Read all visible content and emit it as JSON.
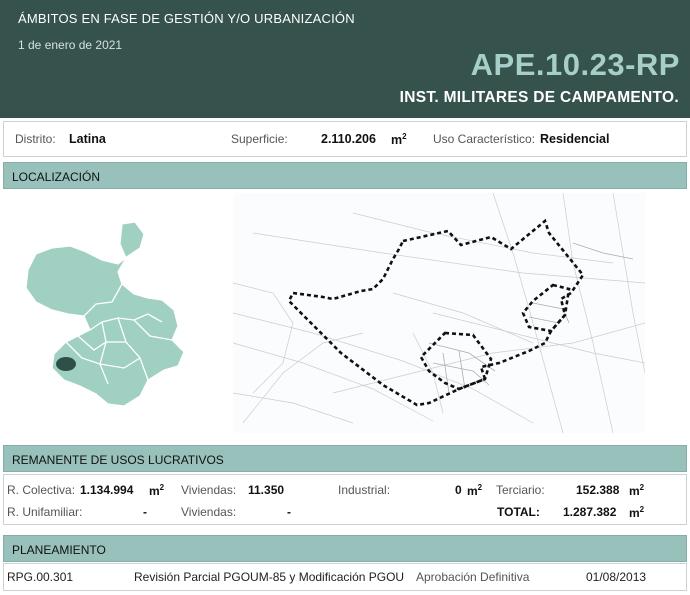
{
  "header": {
    "category": "ÁMBITOS EN FASE DE GESTIÓN Y/O URBANIZACIÓN",
    "date": "1 de enero de 2021",
    "code": "APE.10.23-RP",
    "name": "INST. MILITARES DE CAMPAMENTO."
  },
  "info": {
    "distrito_label": "Distrito:",
    "distrito_value": "Latina",
    "superficie_label": "Superficie:",
    "superficie_value": "2.110.206",
    "superficie_unit": "m",
    "superficie_sup": "2",
    "uso_label": "Uso Característico:",
    "uso_value": "Residencial"
  },
  "localizacion": {
    "title": "LOCALIZACIÓN"
  },
  "remanente": {
    "title": "REMANENTE DE USOS LUCRATIVOS",
    "r_colectiva_label": "R. Colectiva:",
    "r_colectiva_value": "1.134.994",
    "viviendas_label": "Viviendas:",
    "viviendas_value": "11.350",
    "industrial_label": "Industrial:",
    "industrial_value": "0",
    "terciario_label": "Terciario:",
    "terciario_value": "152.388",
    "r_unifamiliar_label": "R. Unifamiliar:",
    "r_unifamiliar_value": "-",
    "viviendas2_label": "Viviendas:",
    "viviendas2_value": "-",
    "total_label": "TOTAL:",
    "total_value": "1.287.382",
    "unit": "m",
    "sup": "2"
  },
  "planeamiento": {
    "title": "PLANEAMIENTO",
    "code": "RPG.00.301",
    "description": "Revisión Parcial PGOUM-85 y Modificación PGOU",
    "status": "Aprobación Definitiva",
    "date": "01/08/2013"
  },
  "colors": {
    "header_bg": "#35524c",
    "code_color": "#a7cfc9",
    "section_bar": "#98c1bb",
    "map_fill": "#9fd0c1",
    "highlight": "#2f4f49"
  }
}
